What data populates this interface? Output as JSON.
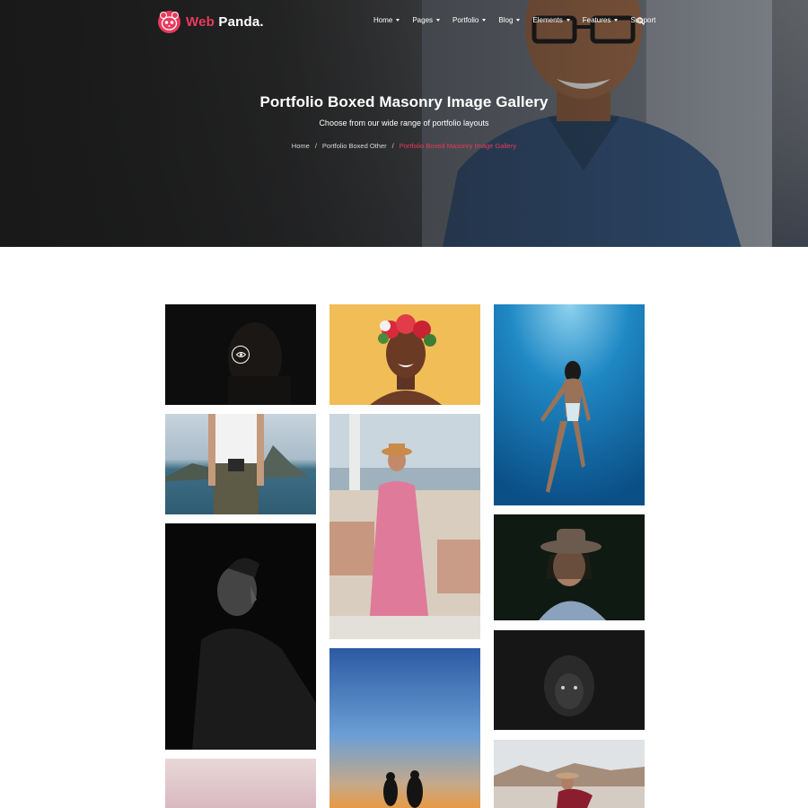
{
  "brand": {
    "name_part1": "Web",
    "name_part2": "Panda.",
    "accent": "#ea3a5c"
  },
  "nav": {
    "items": [
      {
        "label": "Home",
        "dropdown": true
      },
      {
        "label": "Pages",
        "dropdown": true
      },
      {
        "label": "Portfolio",
        "dropdown": true
      },
      {
        "label": "Blog",
        "dropdown": true
      },
      {
        "label": "Elements",
        "dropdown": true
      },
      {
        "label": "Features",
        "dropdown": true
      },
      {
        "label": "Support",
        "dropdown": false
      }
    ],
    "search_icon": "search-icon"
  },
  "hero": {
    "title": "Portfolio Boxed Masonry Image Gallery",
    "subtitle": "Choose from our wide range of portfolio layouts",
    "breadcrumb": [
      "Home",
      "Portfolio Boxed Other",
      "Portfolio Boxed Masonry Image Gallery"
    ]
  },
  "gallery": {
    "hover_icon": "eye-icon",
    "items": [
      {
        "subject": "woman-in-shadow"
      },
      {
        "subject": "woman-with-flower-crown"
      },
      {
        "subject": "swimmer-underwater"
      },
      {
        "subject": "traveler-with-camera"
      },
      {
        "subject": "woman-in-pink-dress"
      },
      {
        "subject": "woman-with-hat"
      },
      {
        "subject": "man-profile-dark"
      },
      {
        "subject": "woman-in-hood-dark"
      },
      {
        "subject": "couple-at-sunset"
      },
      {
        "subject": "woman-in-desert"
      },
      {
        "subject": "pink-sky"
      }
    ]
  }
}
